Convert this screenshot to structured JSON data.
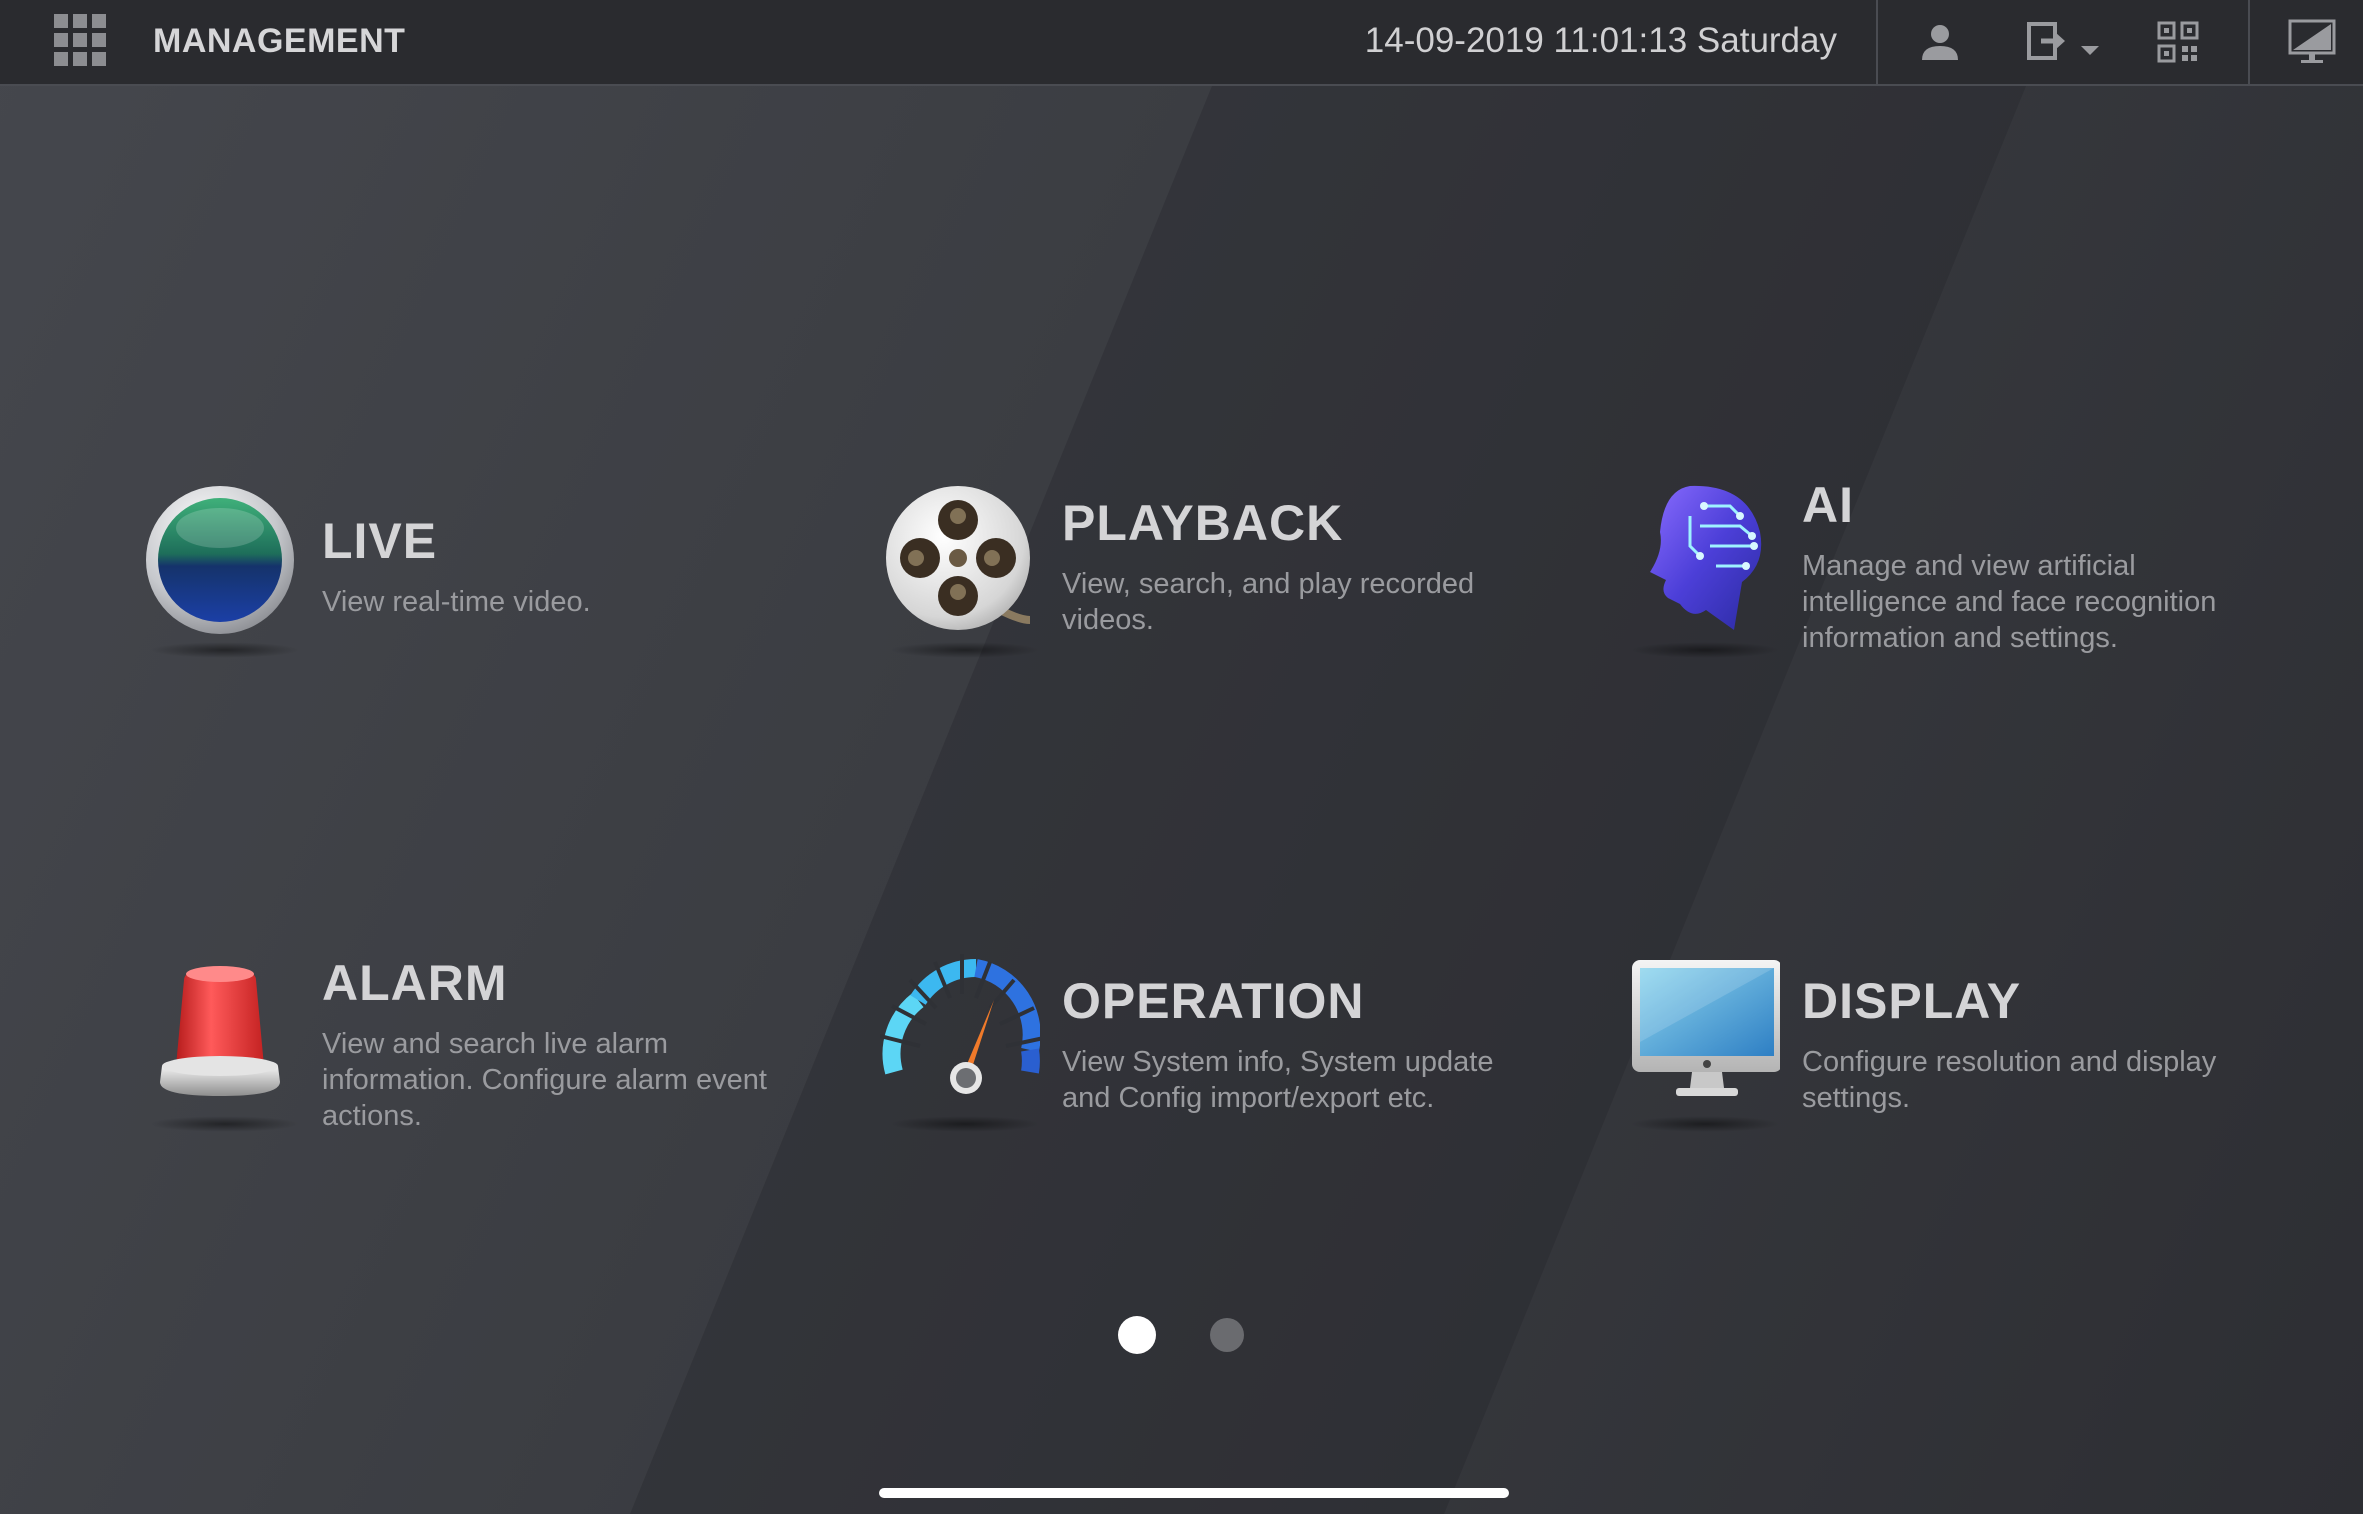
{
  "topbar": {
    "title": "MANAGEMENT",
    "datetime": "14-09-2019 11:01:13 Saturday"
  },
  "tiles": [
    {
      "title": "LIVE",
      "desc": "View real-time video.",
      "icon": "live-globe-icon"
    },
    {
      "title": "PLAYBACK",
      "desc": "View, search, and play recorded videos.",
      "icon": "film-reel-icon"
    },
    {
      "title": "AI",
      "desc": "Manage and view artificial intelligence and face recognition information and settings.",
      "icon": "ai-head-icon"
    },
    {
      "title": "ALARM",
      "desc": "View and search live alarm information. Configure alarm event actions.",
      "icon": "alarm-siren-icon"
    },
    {
      "title": "OPERATION",
      "desc": "View System info, System update and Config import/export etc.",
      "icon": "gauge-icon"
    },
    {
      "title": "DISPLAY",
      "desc": "Configure resolution and display settings.",
      "icon": "monitor-icon"
    }
  ],
  "pagination": {
    "current": 1,
    "total": 2
  },
  "colors": {
    "topbar_bg": "#2a2b2f",
    "title_text": "#d4d4d6",
    "desc_text": "#9a9b9f",
    "alarm_red": "#e63b3b",
    "gauge_blue": "#2e8fe8"
  }
}
